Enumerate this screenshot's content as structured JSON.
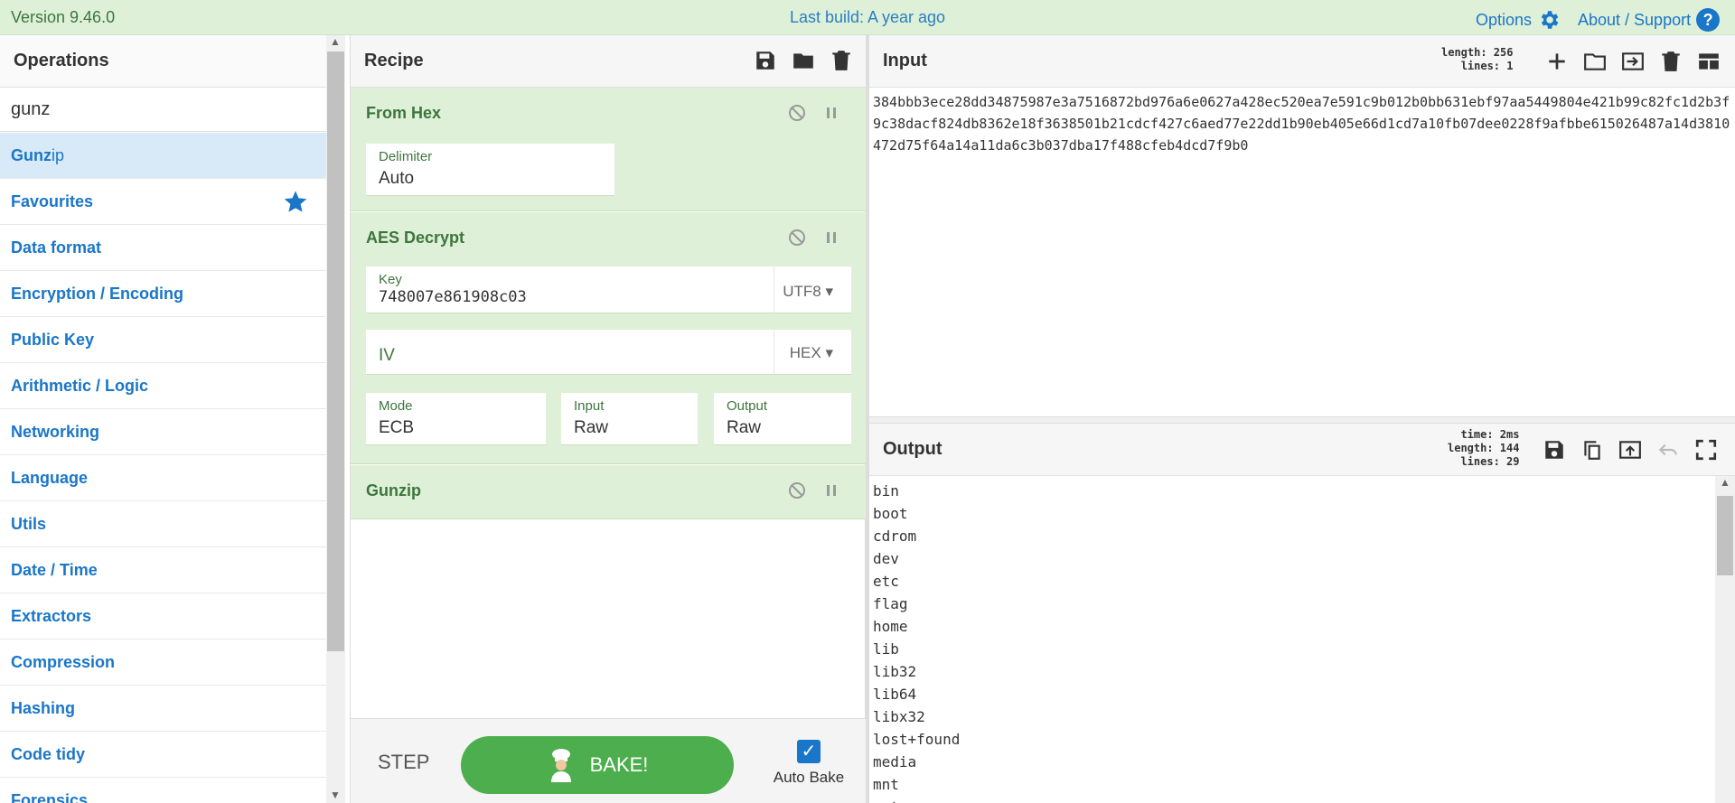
{
  "banner": {
    "version": "Version 9.46.0",
    "build": "Last build: A year ago",
    "options": "Options",
    "about": "About / Support"
  },
  "operations": {
    "title": "Operations",
    "search_value": "gunz",
    "result_match": "Gunz",
    "result_rest": "ip",
    "categories": [
      "Favourites",
      "Data format",
      "Encryption / Encoding",
      "Public Key",
      "Arithmetic / Logic",
      "Networking",
      "Language",
      "Utils",
      "Date / Time",
      "Extractors",
      "Compression",
      "Hashing",
      "Code tidy",
      "Forensics"
    ]
  },
  "recipe": {
    "title": "Recipe",
    "ops": [
      {
        "name": "From Hex",
        "delimiter_label": "Delimiter",
        "delimiter_value": "Auto"
      },
      {
        "name": "AES Decrypt",
        "key_label": "Key",
        "key_value": "748007e861908c03",
        "key_encoding": "UTF8",
        "iv_label": "IV",
        "iv_value": "",
        "iv_encoding": "HEX",
        "mode_label": "Mode",
        "mode_value": "ECB",
        "input_label": "Input",
        "input_value": "Raw",
        "output_label": "Output",
        "output_value": "Raw"
      },
      {
        "name": "Gunzip"
      }
    ],
    "step": "STEP",
    "bake": "BAKE!",
    "auto_bake": "Auto Bake",
    "auto_bake_checked": true
  },
  "input": {
    "title": "Input",
    "length": "length: 256",
    "lines": "lines:   1",
    "text": "384bbb3ece28dd34875987e3a7516872bd976a6e0627a428ec520ea7e591c9b012b0bb631ebf97aa5449804e421b99c82fc1d2b3f9c38dacf824db8362e18f3638501b21cdcf427c6aed77e22dd1b90eb405e66d1cd7a10fb07dee0228f9afbbe615026487a14d3810472d75f64a14a11da6c3b037dba17f488cfeb4dcd7f9b0"
  },
  "output": {
    "title": "Output",
    "time": "time:   2ms",
    "length": "length: 144",
    "lines": "lines:  29",
    "lines_text": [
      "bin",
      "boot",
      "cdrom",
      "dev",
      "etc",
      "flag",
      "home",
      "lib",
      "lib32",
      "lib64",
      "libx32",
      "lost+found",
      "media",
      "mnt",
      "opt"
    ]
  },
  "colors": {
    "banner_bg": "#dff0d8",
    "op_bg": "#dff0d8",
    "op_text": "#3c763d",
    "link": "#1a76c8",
    "bake": "#4cae4c"
  }
}
